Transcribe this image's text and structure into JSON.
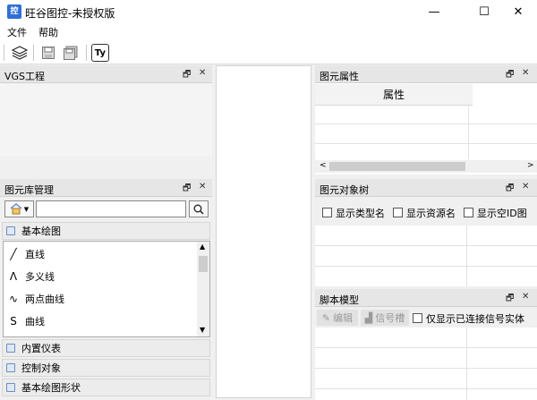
{
  "window": {
    "title": "旺谷图控-未授权版",
    "app_icon": "控",
    "minimize": "—",
    "maximize": "☐",
    "close": "✕"
  },
  "menu": [
    "文件",
    "帮助"
  ],
  "toolbar": {
    "text_tool": "Ty"
  },
  "vgs_panel": {
    "title": "VGS工程"
  },
  "library_panel": {
    "title": "图元库管理",
    "search_placeholder": "",
    "categories": [
      "基本绘图",
      "内置仪表",
      "控制对象",
      "基本绘图形状"
    ],
    "items": [
      {
        "icon": "line-icon",
        "glyph": "╱",
        "label": "直线"
      },
      {
        "icon": "polyline-icon",
        "glyph": "ᐱ",
        "label": "多义线"
      },
      {
        "icon": "two-point-curve-icon",
        "glyph": "∿",
        "label": "两点曲线"
      },
      {
        "icon": "curve-icon",
        "glyph": "S",
        "label": "曲线"
      }
    ]
  },
  "props_panel": {
    "title": "图元属性",
    "column_header": "属性"
  },
  "tree_panel": {
    "title": "图元对象树",
    "checks": [
      "显示类型名",
      "显示资源名",
      "显示空ID图"
    ]
  },
  "script_panel": {
    "title": "脚本模型",
    "edit_btn": "编辑",
    "signal_btn": "信号槽",
    "check_label": "仅显示已连接信号实体"
  },
  "panel_controls": {
    "float": "🗗",
    "close": "✕"
  }
}
